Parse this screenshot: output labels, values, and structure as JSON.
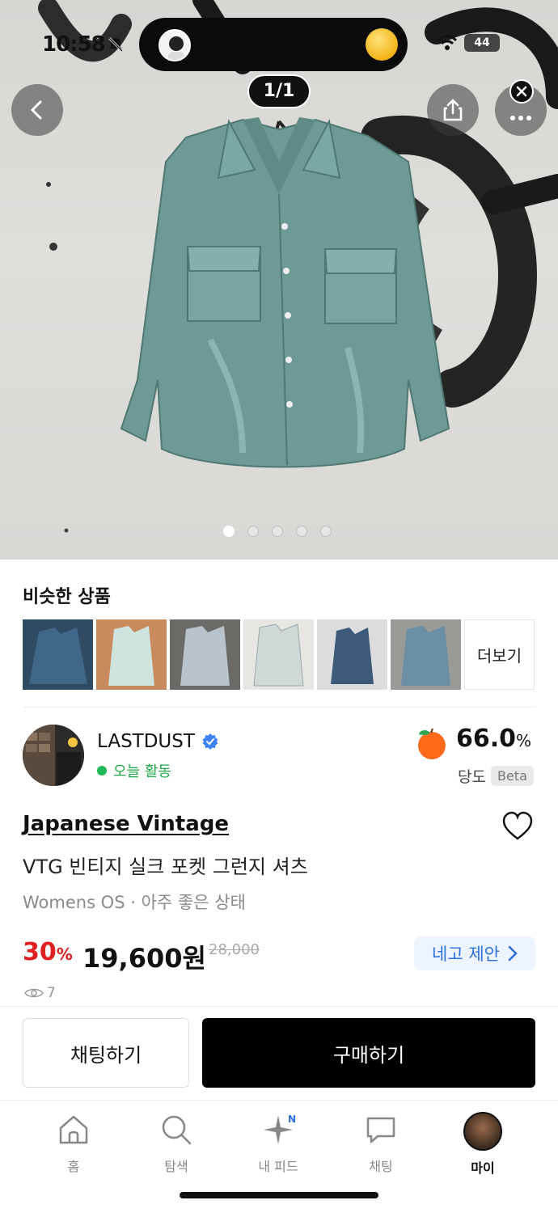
{
  "status_bar": {
    "time": "10:58",
    "battery": "44"
  },
  "image_viewer": {
    "counter": "1/1",
    "dot_count": 5,
    "active_dot": 0
  },
  "similar": {
    "title": "비슷한 상품",
    "more_label": "더보기",
    "thumb_colors": [
      "#2f4a63",
      "#cfe3df",
      "#b8c3cc",
      "#cfd8d6",
      "#3d5a7a",
      "#6a8ea4"
    ]
  },
  "seller": {
    "name": "LASTDUST",
    "activity": "오늘 활동",
    "score": "66.0",
    "score_unit": "%",
    "sweetness_label": "당도",
    "beta_label": "Beta"
  },
  "product": {
    "brand": "Japanese Vintage",
    "title": "VTG 빈티지 실크 포켓 그런지 셔츠",
    "meta": "Womens OS · 아주 좋은 상태",
    "discount": "30",
    "discount_unit": "%",
    "price": "19,600원",
    "original_price": "28,000",
    "negotiate_label": "네고 제안",
    "views": "7"
  },
  "actions": {
    "chat_label": "채팅하기",
    "buy_label": "구매하기"
  },
  "tabbar": {
    "home": "홈",
    "search": "탐색",
    "feed": "내 피드",
    "feed_badge": "N",
    "chat": "채팅",
    "my": "마이"
  },
  "colors": {
    "accent_blue": "#2b6fe0",
    "discount_red": "#e02020",
    "active_green": "#1fa84a",
    "shirt": "#6d9a94"
  }
}
